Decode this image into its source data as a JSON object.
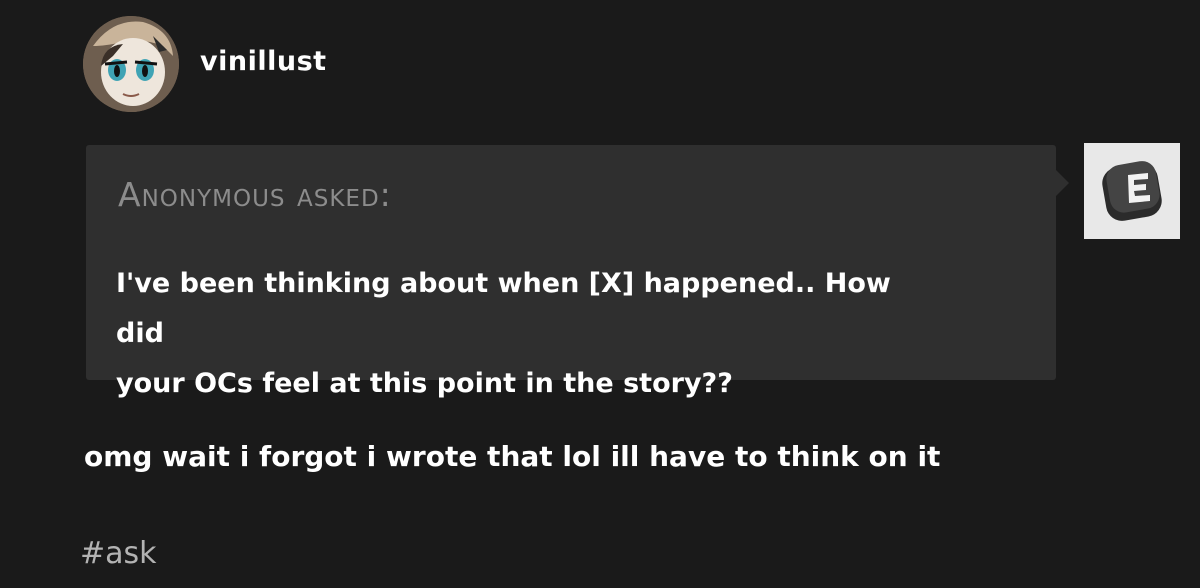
{
  "post": {
    "username": "vinillust",
    "avatar_icon": "user-avatar",
    "ask": {
      "asker": "Anonymous asked:",
      "question_line1": "I've been thinking about when [X] happened.. How did",
      "question_line2": "your OCs feel at this point in the story??",
      "asker_avatar_icon": "anonymous-avatar-icon"
    },
    "answer": "omg wait i forgot i wrote that lol ill have to think on it",
    "tags": [
      "#ask"
    ]
  },
  "colors": {
    "background": "#1a1a1a",
    "ask_box": "#2f2f2f",
    "asker_text": "#8c8c8c",
    "body_text": "#ffffff",
    "tag_text": "#b3b3b3"
  }
}
